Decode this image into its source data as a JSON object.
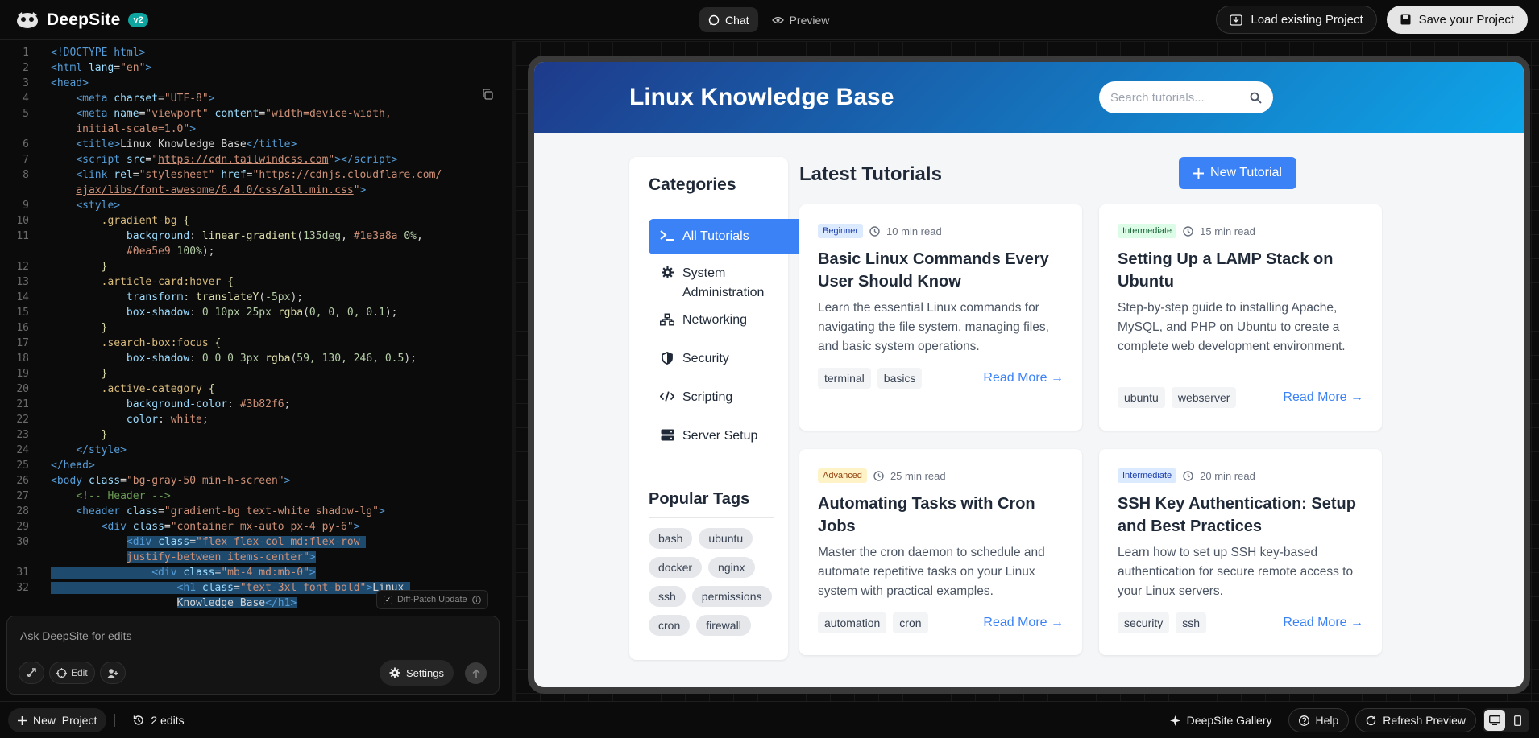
{
  "app": {
    "name": "DeepSite",
    "version_badge": "v2"
  },
  "top_tabs": [
    {
      "label": "Chat",
      "icon": "chat-icon",
      "active": true
    },
    {
      "label": "Preview",
      "icon": "eye-icon",
      "active": false
    }
  ],
  "top_actions": {
    "load_label": "Load existing Project",
    "save_label": "Save your Project"
  },
  "editor": {
    "lines": [
      {
        "n": "1",
        "html": "<span class='t'>&lt;!DOCTYPE html&gt;</span>"
      },
      {
        "n": "2",
        "html": "<span class='t'>&lt;html</span> <span class='a'>lang</span>=<span class='s'>\"en\"</span><span class='t'>&gt;</span>"
      },
      {
        "n": "3",
        "html": "<span class='t'>&lt;head&gt;</span>"
      },
      {
        "n": "4",
        "html": "    <span class='t'>&lt;meta</span> <span class='a'>charset</span>=<span class='s'>\"UTF-8\"</span><span class='t'>&gt;</span>"
      },
      {
        "n": "5",
        "html": "    <span class='t'>&lt;meta</span> <span class='a'>name</span>=<span class='s'>\"viewport\"</span> <span class='a'>content</span>=<span class='s'>\"width=device-width,</span>"
      },
      {
        "n": "",
        "html": "    <span class='s'>initial-scale=1.0\"</span><span class='t'>&gt;</span>"
      },
      {
        "n": "6",
        "html": "    <span class='t'>&lt;title&gt;</span>Linux Knowledge Base<span class='t'>&lt;/title&gt;</span>"
      },
      {
        "n": "7",
        "html": "    <span class='t'>&lt;script</span> <span class='a'>src</span>=<span class='s'>\"</span><span class='u'>https://cdn.tailwindcss.com</span><span class='s'>\"</span><span class='t'>&gt;&lt;/script&gt;</span>"
      },
      {
        "n": "8",
        "html": "    <span class='t'>&lt;link</span> <span class='a'>rel</span>=<span class='s'>\"stylesheet\"</span> <span class='a'>href</span>=<span class='s'>\"</span><span class='u'>https://cdnjs.cloudflare.com/</span>"
      },
      {
        "n": "",
        "html": "    <span class='u'>ajax/libs/font-awesome/6.4.0/css/all.min.css</span><span class='s'>\"</span><span class='t'>&gt;</span>"
      },
      {
        "n": "9",
        "html": "    <span class='t'>&lt;style&gt;</span>"
      },
      {
        "n": "10",
        "html": "        <span class='p'>.gradient-bg</span> <span class='y'>{</span>"
      },
      {
        "n": "11",
        "html": "            <span class='a'>background</span>: <span class='y'>linear-gradient</span>(<span class='n'>135deg</span>, <span class='s'>#1e3a8a</span> <span class='n'>0%</span>,"
      },
      {
        "n": "",
        "html": "            <span class='s'>#0ea5e9</span> <span class='n'>100%</span>);"
      },
      {
        "n": "12",
        "html": "        <span class='y'>}</span>"
      },
      {
        "n": "13",
        "html": "        <span class='p'>.article-card:hover</span> <span class='y'>{</span>"
      },
      {
        "n": "14",
        "html": "            <span class='a'>transform</span>: <span class='y'>translateY</span>(<span class='n'>-5px</span>);"
      },
      {
        "n": "15",
        "html": "            <span class='a'>box-shadow</span>: <span class='n'>0 10px 25px</span> <span class='y'>rgba</span>(<span class='n'>0, 0, 0, 0.1</span>);"
      },
      {
        "n": "16",
        "html": "        <span class='y'>}</span>"
      },
      {
        "n": "17",
        "html": "        <span class='p'>.search-box:focus</span> <span class='y'>{</span>"
      },
      {
        "n": "18",
        "html": "            <span class='a'>box-shadow</span>: <span class='n'>0 0 0 3px</span> <span class='y'>rgba</span>(<span class='n'>59, 130, 246, 0.5</span>);"
      },
      {
        "n": "19",
        "html": "        <span class='y'>}</span>"
      },
      {
        "n": "20",
        "html": "        <span class='p'>.active-category</span> <span class='y'>{</span>"
      },
      {
        "n": "21",
        "html": "            <span class='a'>background-color</span>: <span class='s'>#3b82f6</span>;"
      },
      {
        "n": "22",
        "html": "            <span class='a'>color</span>: <span class='s'>white</span>;"
      },
      {
        "n": "23",
        "html": "        <span class='y'>}</span>"
      },
      {
        "n": "24",
        "html": "    <span class='t'>&lt;/style&gt;</span>"
      },
      {
        "n": "25",
        "html": "<span class='t'>&lt;/head&gt;</span>"
      },
      {
        "n": "26",
        "html": "<span class='t'>&lt;body</span> <span class='a'>class</span>=<span class='s'>\"bg-gray-50 min-h-screen\"</span><span class='t'>&gt;</span>"
      },
      {
        "n": "27",
        "html": "    <span class='cm'>&lt;!-- Header --&gt;</span>"
      },
      {
        "n": "28",
        "html": "    <span class='t'>&lt;header</span> <span class='a'>class</span>=<span class='s'>\"gradient-bg text-white shadow-lg\"</span><span class='t'>&gt;</span>"
      },
      {
        "n": "29",
        "html": "        <span class='t'>&lt;div</span> <span class='a'>class</span>=<span class='s'>\"container mx-auto px-4 py-6\"</span><span class='t'>&gt;</span>"
      },
      {
        "n": "30",
        "html": "            <span class='sel'><span class='t'>&lt;div</span> <span class='a'>class</span>=<span class='s'>\"flex flex-col md:flex-row</span> </span>"
      },
      {
        "n": "",
        "html": "            <span class='sel'><span class='s'>justify-between items-center\"</span><span class='t'>&gt;</span></span>"
      },
      {
        "n": "31",
        "html": "<span class='sel'>                <span class='t'>&lt;div</span> <span class='a'>class</span>=<span class='s'>\"mb-4 md:mb-0\"</span><span class='t'>&gt;</span></span>"
      },
      {
        "n": "32",
        "html": "<span class='sel'>                    <span class='t'>&lt;h1</span> <span class='a'>class</span>=<span class='s'>\"text-3xl font-bold\"</span><span class='t'>&gt;</span>Linux </span>"
      },
      {
        "n": "",
        "html": "                    <span class='sel'>Knowledge Base<span class='t'>&lt;/h1&gt;</span></span>"
      }
    ]
  },
  "diff_patch": {
    "label": "Diff-Patch Update",
    "checked": true
  },
  "ask": {
    "placeholder": "Ask DeepSite for edits",
    "edit_label": "Edit",
    "settings_label": "Settings"
  },
  "preview": {
    "site_title": "Linux Knowledge Base",
    "search_placeholder": "Search tutorials...",
    "categories_title": "Categories",
    "categories": [
      {
        "label": "All Tutorials",
        "icon": "terminal-icon",
        "active": true
      },
      {
        "label": "System Administration",
        "icon": "cog-icon",
        "active": false
      },
      {
        "label": "Networking",
        "icon": "network-icon",
        "active": false
      },
      {
        "label": "Security",
        "icon": "shield-icon",
        "active": false
      },
      {
        "label": "Scripting",
        "icon": "code-icon",
        "active": false
      },
      {
        "label": "Server Setup",
        "icon": "server-icon",
        "active": false
      }
    ],
    "popular_tags_title": "Popular Tags",
    "popular_tags": [
      "bash",
      "ubuntu",
      "docker",
      "nginx",
      "ssh",
      "permissions",
      "cron",
      "firewall"
    ],
    "latest_title": "Latest Tutorials",
    "new_tutorial_label": "New Tutorial",
    "cards": [
      {
        "level": "Beginner",
        "read_time": "10 min read",
        "title": "Basic Linux Commands Every User Should Know",
        "desc": "Learn the essential Linux commands for navigating the file system, managing files, and basic system operations.",
        "tags": [
          "terminal",
          "basics"
        ],
        "read_more": "Read More →"
      },
      {
        "level": "Intermediate",
        "read_time": "15 min read",
        "title": "Setting Up a LAMP Stack on Ubuntu",
        "desc": "Step-by-step guide to installing Apache, MySQL, and PHP on Ubuntu to create a complete web development environment.",
        "tags": [
          "ubuntu",
          "webserver"
        ],
        "read_more": "Read More →"
      },
      {
        "level": "Advanced",
        "read_time": "25 min read",
        "title": "Automating Tasks with Cron Jobs",
        "desc": "Master the cron daemon to schedule and automate repetitive tasks on your Linux system with practical examples.",
        "tags": [
          "automation",
          "cron"
        ],
        "read_more": "Read More →"
      },
      {
        "level": "Intermediate",
        "read_time": "20 min read",
        "title": "SSH Key Authentication: Setup and Best Practices",
        "desc": "Learn how to set up SSH key-based authentication for secure remote access to your Linux servers.",
        "tags": [
          "security",
          "ssh"
        ],
        "read_more": "Read More →"
      }
    ]
  },
  "bottom": {
    "new_project_label": "New  Project",
    "edits_label": "2 edits",
    "gallery_label": "DeepSite Gallery",
    "help_label": "Help",
    "refresh_label": "Refresh Preview"
  }
}
